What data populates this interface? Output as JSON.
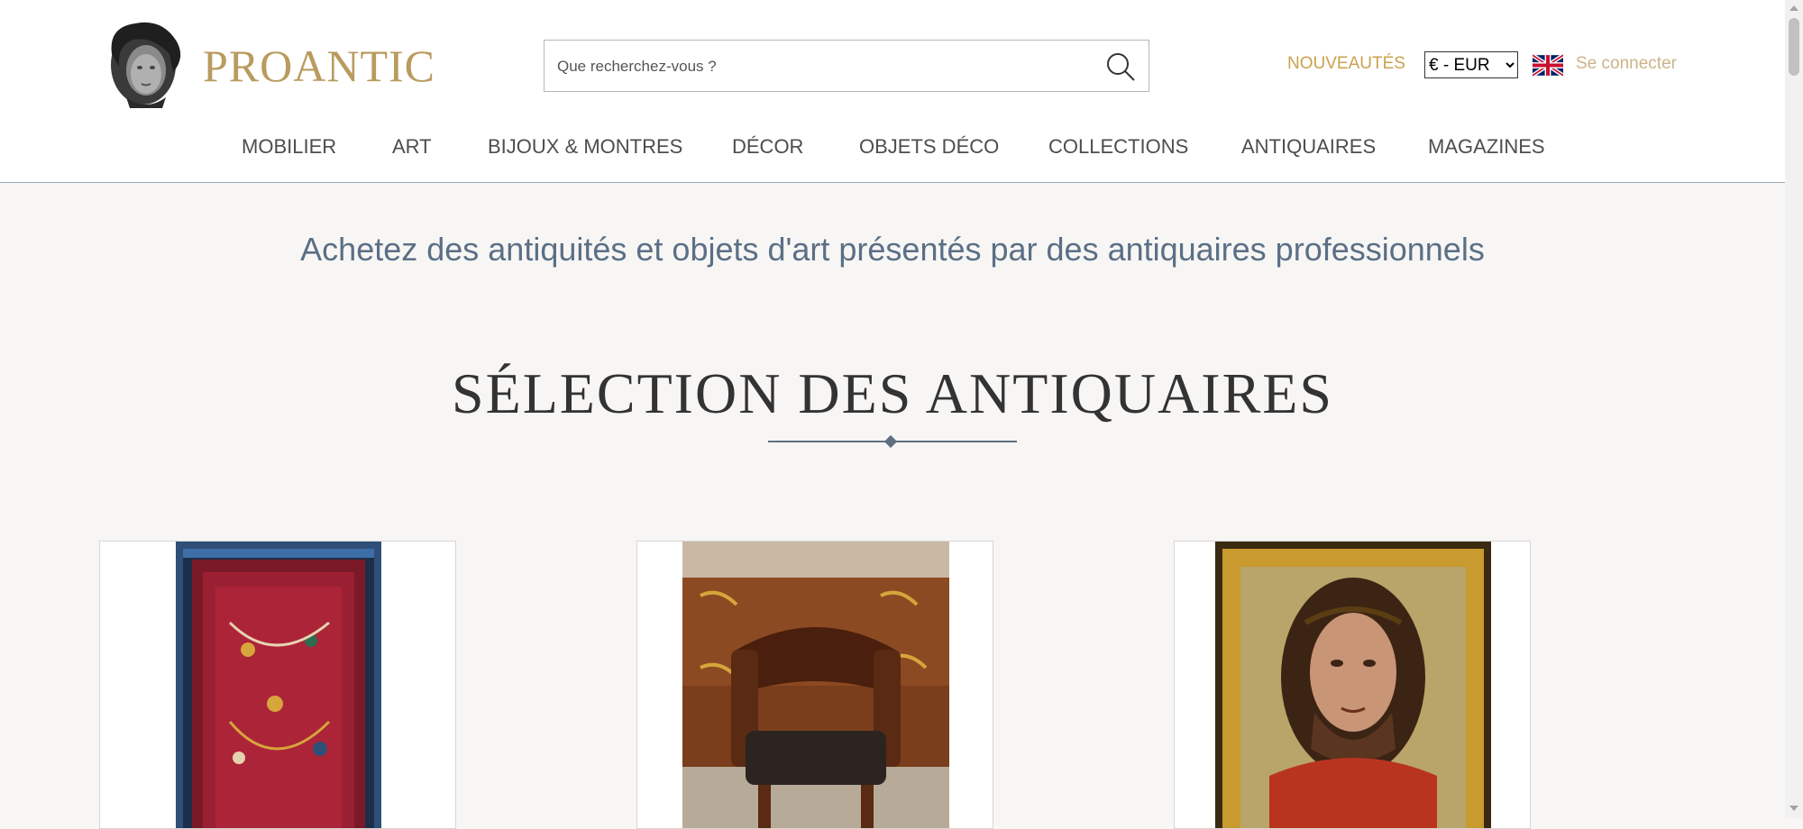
{
  "brand": {
    "name": "PROANTIC",
    "logo_icon": "bust-icon"
  },
  "search": {
    "placeholder": "Que recherchez-vous ?",
    "icon": "search-icon"
  },
  "header": {
    "new_label": "NOUVEAUTÉS",
    "currency_selected": "€ - EUR",
    "language_icon": "uk-flag-icon",
    "login_label": "Se connecter"
  },
  "nav": {
    "items": [
      {
        "label": "MOBILIER"
      },
      {
        "label": "ART"
      },
      {
        "label": "BIJOUX & MONTRES"
      },
      {
        "label": "DÉCOR"
      },
      {
        "label": "OBJETS DÉCO"
      },
      {
        "label": "COLLECTIONS"
      },
      {
        "label": "ANTIQUAIRES"
      },
      {
        "label": "MAGAZINES"
      }
    ]
  },
  "main": {
    "tagline": "Achetez des antiquités et objets d'art présentés par des antiquaires professionnels",
    "section_title": "SÉLECTION DES ANTIQUAIRES"
  },
  "colors": {
    "brand_gold": "#b89b5e",
    "link_gold": "#c9a24d",
    "tagline_blue": "#5b6f86",
    "page_bg": "#f7f6f4"
  }
}
